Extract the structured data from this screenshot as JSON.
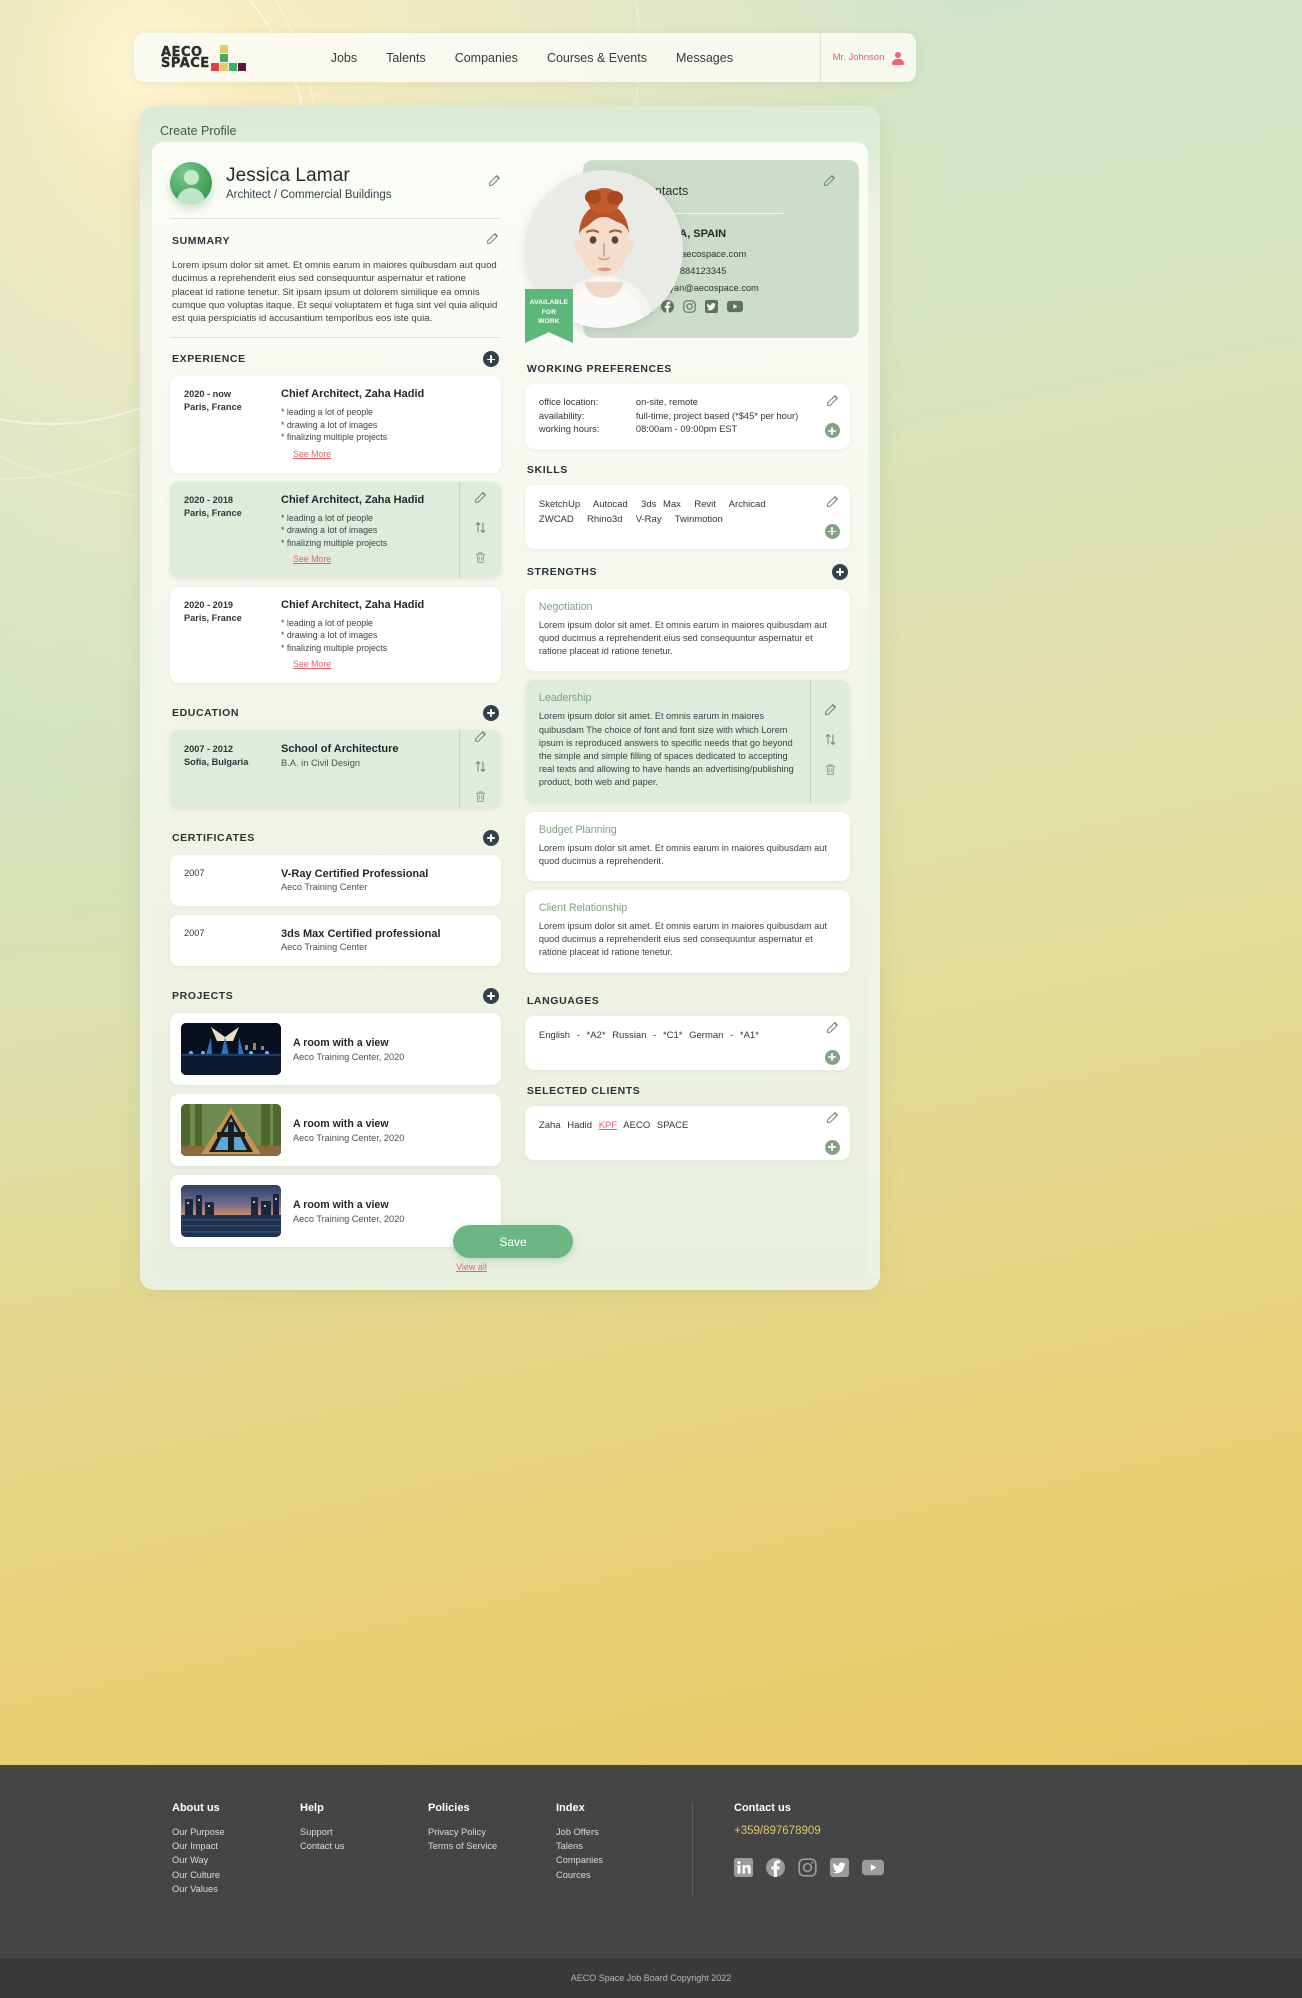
{
  "nav": {
    "logo_line1": "AECO",
    "logo_line2": "SPACE",
    "links": [
      "Jobs",
      "Talents",
      "Companies",
      "Courses & Events",
      "Messages"
    ],
    "user_name": "Mr. Johnson"
  },
  "panel": {
    "title": "Create Profile",
    "save_label": "Save"
  },
  "profile": {
    "name": "Jessica Lamar",
    "role": "Architect / Commercial Buildings"
  },
  "summary": {
    "heading": "SUMMARY",
    "text": "Lorem ipsum dolor sit amet. Et omnis earum in maiores quibusdam aut quod ducimus a reprehenderit eius sed consequuntur aspernatur et ratione placeat id ratione tenetur. Sit ipsam ipsum ut dolorem similique ea omnis cumque quo voluptas itaque. Et sequi voluptatem et fuga sint vel quia aliquid est quia perspiciatis id accusantium temporibus eos iste quia."
  },
  "experience": {
    "heading": "EXPERIENCE",
    "see_more": "See More",
    "items": [
      {
        "date": "2020 - now",
        "location": "Paris, France",
        "title": "Chief Architect, Zaha Hadid",
        "bullets": [
          "* leading a lot of people",
          "* drawing a lot of images",
          "* finalizing multiple projects"
        ],
        "selected": false
      },
      {
        "date": "2020 - 2018",
        "location": "Paris, France",
        "title": "Chief Architect, Zaha Hadid",
        "bullets": [
          "* leading a lot of people",
          "* drawing a lot of images",
          "* finalizing multiple projects"
        ],
        "selected": true
      },
      {
        "date": "2020 - 2019",
        "location": "Paris, France",
        "title": "Chief Architect, Zaha Hadid",
        "bullets": [
          "* leading a lot of people",
          "* drawing a lot of images",
          "* finalizing multiple projects"
        ],
        "selected": false
      }
    ]
  },
  "education": {
    "heading": "EDUCATION",
    "items": [
      {
        "date": "2007 - 2012",
        "location": "Sofia, Bulgaria",
        "school": "School of Architecture",
        "degree": "B.A. in Civil Design",
        "selected": true
      }
    ]
  },
  "certificates": {
    "heading": "CERTIFICATES",
    "items": [
      {
        "year": "2007",
        "name": "V-Ray Certified Professional",
        "org": "Aeco Training Center"
      },
      {
        "year": "2007",
        "name": "3ds Max Certified professional",
        "org": "Aeco Training Center"
      }
    ]
  },
  "projects": {
    "heading": "PROJECTS",
    "view_all": "View all",
    "items": [
      {
        "title": "A room with a view",
        "sub": "Aeco Training Center, 2020",
        "thumb": "night-bridge"
      },
      {
        "title": "A room with a view",
        "sub": "Aeco Training Center, 2020",
        "thumb": "a-frame-cabin"
      },
      {
        "title": "A room with a view",
        "sub": "Aeco Training Center, 2020",
        "thumb": "river-dusk"
      }
    ]
  },
  "contacts": {
    "heading": "Contacts",
    "city": "MALAGA, SPAIN",
    "website": "www.aecospace.com",
    "phone": "+359884123345",
    "email": "deyan@aecospace.com",
    "badge_line1": "AVAILABLE",
    "badge_line2": "FOR",
    "badge_line3": "WORK",
    "socials": [
      "linkedin-icon",
      "facebook-icon",
      "instagram-icon",
      "twitter-icon",
      "youtube-icon"
    ]
  },
  "working_preferences": {
    "heading": "WORKING PREFERENCES",
    "rows": [
      {
        "key": "office location:",
        "value": "on-site, remote"
      },
      {
        "key": "availability:",
        "value": "full-time, project based (*$45* per hour)"
      },
      {
        "key": "working hours:",
        "value": "08:00am - 09:00pm EST"
      }
    ]
  },
  "skills": {
    "heading": "SKILLS",
    "items": [
      "SketchUp",
      "Autocad",
      "3ds Max",
      "Revit",
      "Archicad",
      "ZWCAD",
      "Rhino3d",
      "V-Ray",
      "Twinmotion"
    ]
  },
  "strengths": {
    "heading": "STRENGTHS",
    "items": [
      {
        "title": "Negotiation",
        "text": "Lorem ipsum dolor sit amet. Et omnis earum in maiores quibusdam aut quod ducimus a reprehenderit eius sed consequuntur aspernatur et ratione placeat id ratione tenetur.",
        "selected": false
      },
      {
        "title": "Leadership",
        "text": "Lorem ipsum dolor sit amet. Et omnis earum in maiores quibusdam The choice of font and font size with which Lorem ipsum is reproduced answers to specific needs that go beyond the simple and simple filling of spaces dedicated to accepting real texts and allowing to have hands an advertising/publishing product, both web and paper.",
        "selected": true
      },
      {
        "title": "Budget Planning",
        "text": "Lorem ipsum dolor sit amet. Et omnis earum in maiores quibusdam aut quod ducimus a reprehenderit.",
        "selected": false
      },
      {
        "title": "Client Relationship",
        "text": "Lorem ipsum dolor sit amet. Et omnis earum in maiores quibusdam aut quod ducimus a reprehenderit eius sed consequuntur aspernatur et ratione placeat id ratione tenetur.",
        "selected": false
      }
    ]
  },
  "languages": {
    "heading": "LANGUAGES",
    "text": "English - *A2*   Russian - *C1*   German - *A1*"
  },
  "selected_clients": {
    "heading": "SELECTED CLIENTS",
    "before": "Zaha Hadid",
    "highlight": "KPF",
    "after": "AECO SPACE"
  },
  "footer": {
    "columns": [
      {
        "title": "About us",
        "links": [
          "Our Purpose",
          "Our Impact",
          "Our Way",
          "Our Culture",
          "Our Values"
        ]
      },
      {
        "title": "Help",
        "links": [
          "Support",
          "Contact us"
        ]
      },
      {
        "title": "Policies",
        "links": [
          "Privacy Policy",
          "Terms of Service"
        ]
      },
      {
        "title": "Index",
        "links": [
          "Job Offers",
          "Talens",
          "Companies",
          "Cources"
        ]
      }
    ],
    "contact_title": "Contact us",
    "phone": "+359/897678909",
    "socials": [
      "linkedin-icon",
      "facebook-icon",
      "instagram-icon",
      "twitter-icon",
      "youtube-icon"
    ],
    "copyright": "AECO Space Job Board Copyright 2022"
  },
  "colors": {
    "accent_red": "#e8606a",
    "accent_green": "#6cb684",
    "panel_green": "#cddccb",
    "selected_card": "#dfebdc",
    "footer_bg": "#454545",
    "footer_phone": "#dcc96a"
  }
}
